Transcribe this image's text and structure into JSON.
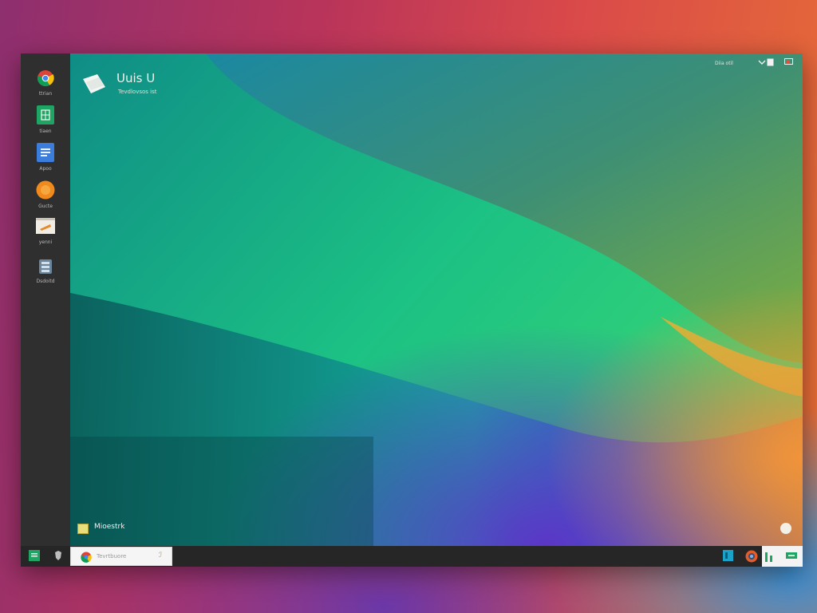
{
  "colors": {
    "sidebar_bg": "#2f2f30",
    "taskbar_bg": "#262626",
    "wallpaper_teal": "#14a98f",
    "wallpaper_green": "#6fa648",
    "wallpaper_orange": "#e6a43a",
    "wallpaper_purple": "#6a37a8"
  },
  "desktop": {
    "title": "Uuis U",
    "subtitle": "Tevdlovsos ist",
    "tray_text": "Diia otil",
    "bottom_note_label": "Mioestrk"
  },
  "sidebar": {
    "items": [
      {
        "label": "ttrian",
        "icon": "chrome-icon"
      },
      {
        "label": "tiaen",
        "icon": "sheets-icon"
      },
      {
        "label": "Apoo",
        "icon": "docs-icon"
      },
      {
        "label": "Gucte",
        "icon": "orange-circle-icon"
      },
      {
        "label": "yenni",
        "icon": "notes-icon"
      },
      {
        "label": "Dsdoitd",
        "icon": "files-icon"
      }
    ]
  },
  "taskbar": {
    "search_placeholder": "Tevrtbuore",
    "search_glyph": "ℐ"
  }
}
